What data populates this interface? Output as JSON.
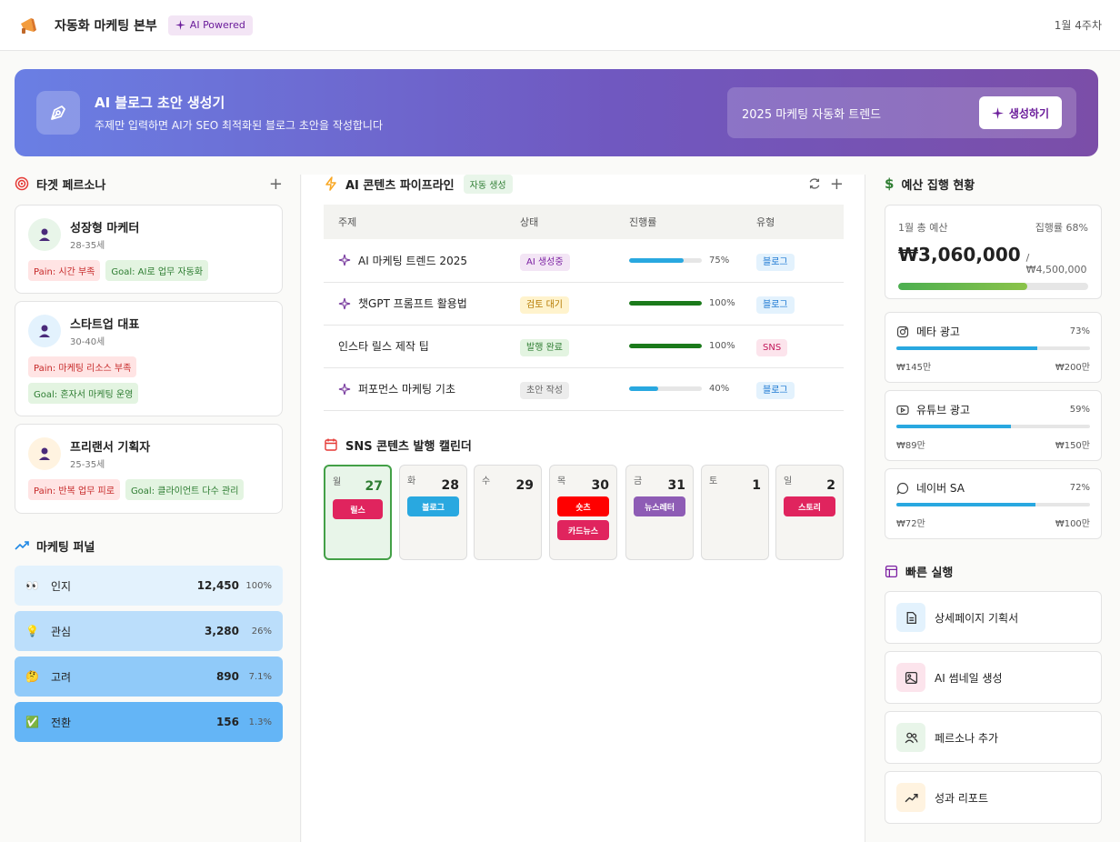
{
  "header": {
    "title": "자동화 마케팅 본부",
    "badge": "AI Powered",
    "week": "1월 4주차"
  },
  "hero": {
    "title": "AI 블로그 초안 생성기",
    "subtitle": "주제만 입력하면 AI가 SEO 최적화된 블로그 초안을 작성합니다",
    "input_value": "2025 마케팅 자동화 트렌드",
    "button": "생성하기"
  },
  "personas": {
    "title": "타겟 페르소나",
    "items": [
      {
        "name": "성장형 마케터",
        "age": "28-35세",
        "pain": "Pain: 시간 부족",
        "goal": "Goal: AI로 업무 자동화"
      },
      {
        "name": "스타트업 대표",
        "age": "30-40세",
        "pain": "Pain: 마케팅 리소스 부족",
        "goal": "Goal: 혼자서 마케팅 운영"
      },
      {
        "name": "프리랜서 기획자",
        "age": "25-35세",
        "pain": "Pain: 반복 업무 피로",
        "goal": "Goal: 클라이언트 다수 관리"
      }
    ]
  },
  "funnel": {
    "title": "마케팅 퍼널",
    "items": [
      {
        "label": "인지",
        "value": "12,450",
        "pct": "100%"
      },
      {
        "label": "관심",
        "value": "3,280",
        "pct": "26%"
      },
      {
        "label": "고려",
        "value": "890",
        "pct": "7.1%"
      },
      {
        "label": "전환",
        "value": "156",
        "pct": "1.3%"
      }
    ]
  },
  "pipeline": {
    "title": "AI 콘텐츠 파이프라인",
    "badge": "자동 생성",
    "columns": [
      "주제",
      "상태",
      "진행률",
      "유형"
    ],
    "rows": [
      {
        "topic": "AI 마케팅 트렌드 2025",
        "status": "AI 생성중",
        "progress": 75,
        "progress_label": "75%",
        "type": "블로그"
      },
      {
        "topic": "챗GPT 프롬프트 활용법",
        "status": "검토 대기",
        "progress": 100,
        "progress_label": "100%",
        "type": "블로그"
      },
      {
        "topic": "인스타 릴스 제작 팁",
        "status": "발행 완료",
        "progress": 100,
        "progress_label": "100%",
        "type": "SNS"
      },
      {
        "topic": "퍼포먼스 마케팅 기초",
        "status": "초안 작성",
        "progress": 40,
        "progress_label": "40%",
        "type": "블로그"
      }
    ]
  },
  "calendar": {
    "title": "SNS 콘텐츠 발행 캘린더",
    "days": [
      {
        "dow": "월",
        "date": "27",
        "items": [
          "릴스"
        ]
      },
      {
        "dow": "화",
        "date": "28",
        "items": [
          "블로그"
        ]
      },
      {
        "dow": "수",
        "date": "29",
        "items": []
      },
      {
        "dow": "목",
        "date": "30",
        "items": [
          "숏츠",
          "카드뉴스"
        ]
      },
      {
        "dow": "금",
        "date": "31",
        "items": [
          "뉴스레터"
        ]
      },
      {
        "dow": "토",
        "date": "1",
        "items": []
      },
      {
        "dow": "일",
        "date": "2",
        "items": [
          "스토리"
        ]
      }
    ]
  },
  "budget": {
    "title": "예산 집행 현황",
    "label": "1월 총 예산",
    "rate_label": "집행률 68%",
    "rate": 68,
    "spent": "₩3,060,000",
    "total": "/ ₩4,500,000",
    "channels": [
      {
        "name": "메타 광고",
        "pct": "73%",
        "rate": 73,
        "spent": "₩145만",
        "total": "₩200만"
      },
      {
        "name": "유튜브 광고",
        "pct": "59%",
        "rate": 59,
        "spent": "₩89만",
        "total": "₩150만"
      },
      {
        "name": "네이버 SA",
        "pct": "72%",
        "rate": 72,
        "spent": "₩72만",
        "total": "₩100만"
      }
    ]
  },
  "quick": {
    "title": "빠른 실행",
    "items": [
      "상세페이지 기획서",
      "AI 썸네일 생성",
      "페르소나 추가",
      "성과 리포트"
    ]
  },
  "colors": {
    "accent": "#6a1b9a",
    "blue_bar": "#29a8e0",
    "green_bar": "#1b7a1b"
  }
}
